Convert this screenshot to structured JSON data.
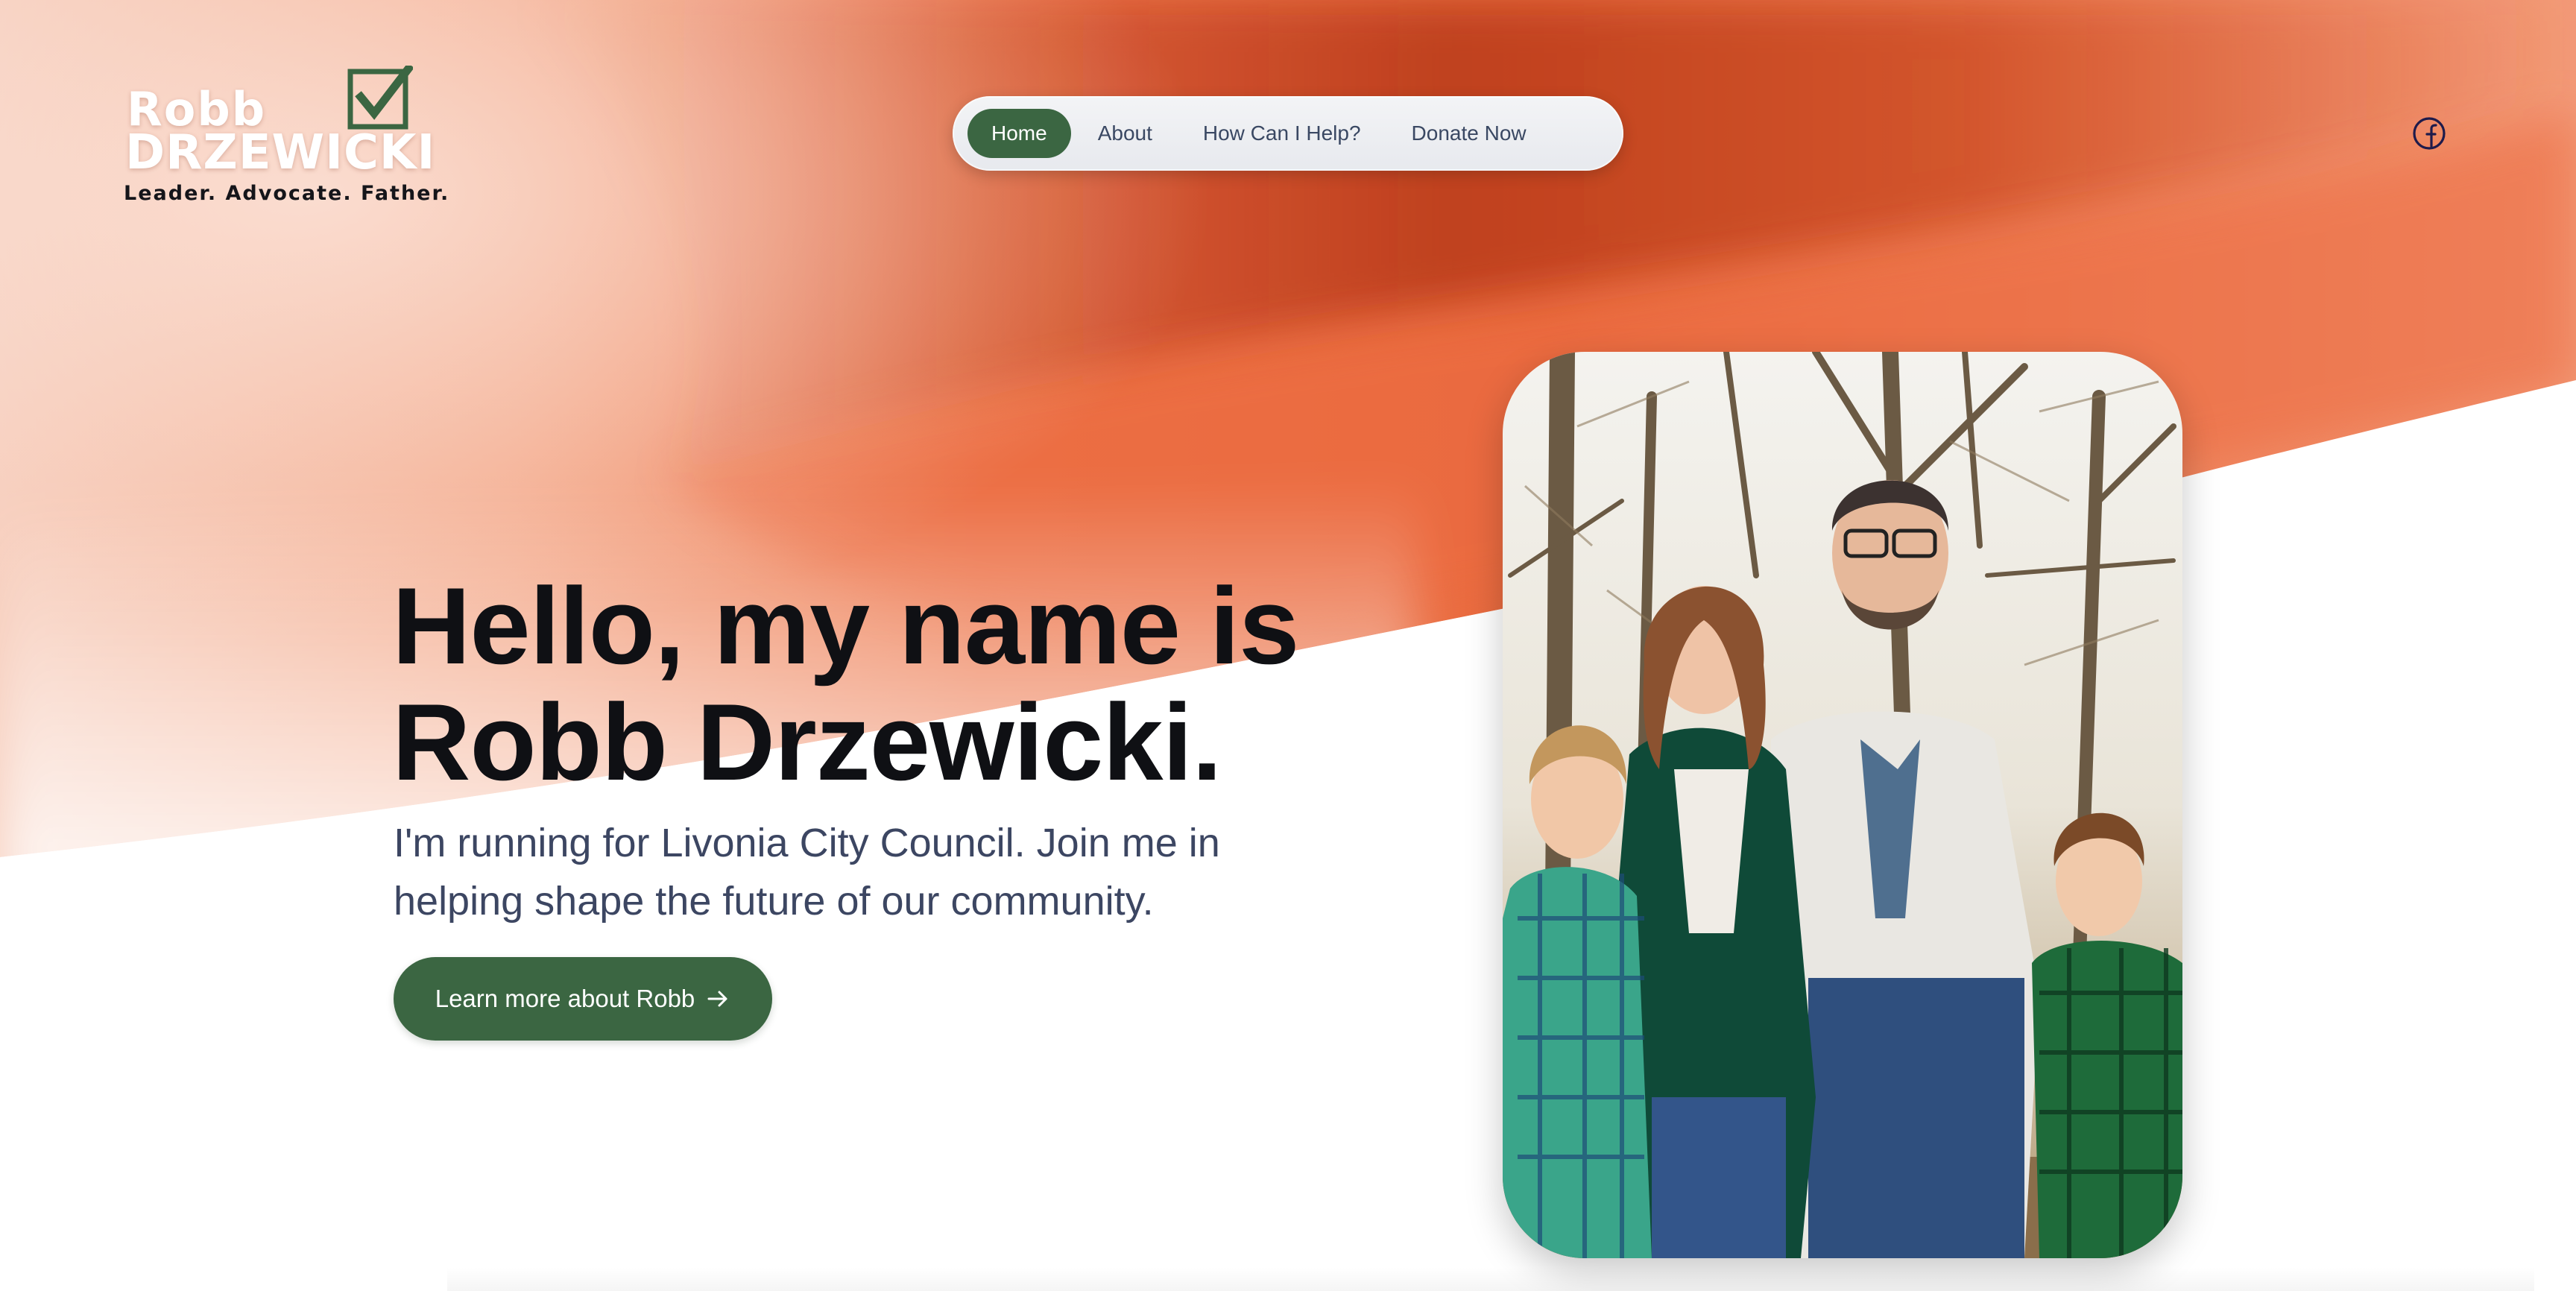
{
  "logo": {
    "first_name": "Robb",
    "last_name": "DRZEWICKI",
    "tagline": "Leader. Advocate. Father.",
    "check_icon": "checkbox-check-icon"
  },
  "nav": {
    "items": [
      {
        "label": "Home",
        "active": true
      },
      {
        "label": "About",
        "active": false
      },
      {
        "label": "How Can I Help?",
        "active": false
      },
      {
        "label": "Donate Now",
        "active": false
      }
    ]
  },
  "social": {
    "facebook_icon": "facebook-icon"
  },
  "hero": {
    "title_line1": "Hello, my name is",
    "title_line2": "Robb Drzewicki.",
    "subtitle_line1": "I'm running for Livonia City Council. Join me in",
    "subtitle_line2": "helping shape the future of our community.",
    "cta_label": "Learn more about Robb",
    "cta_icon": "arrow-right-icon"
  },
  "colors": {
    "brand_green": "#3b6642",
    "accent_orange": "#e8673d",
    "nav_text": "#3a4863",
    "title_text": "#0f1014",
    "subtitle_text": "#3c4662"
  }
}
